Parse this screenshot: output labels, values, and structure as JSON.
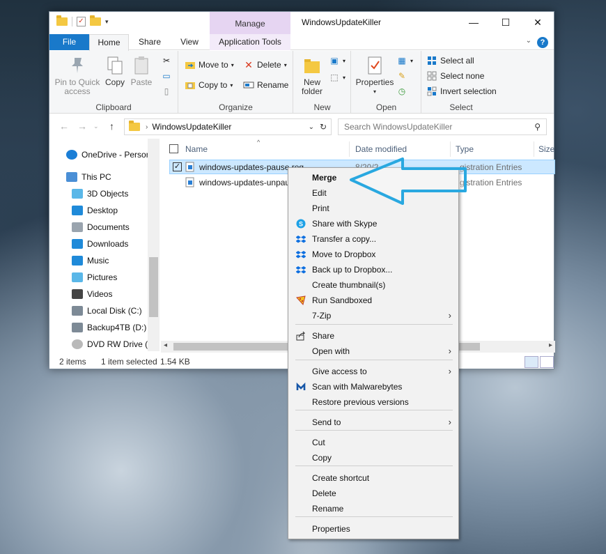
{
  "window": {
    "title": "WindowsUpdateKiller",
    "manage_label": "Manage",
    "controls": [
      "—",
      "☐",
      "✕"
    ]
  },
  "tabs": {
    "file": "File",
    "home": "Home",
    "share": "Share",
    "view": "View",
    "app_tools": "Application Tools",
    "help": "?"
  },
  "ribbon": {
    "clipboard": {
      "label": "Clipboard",
      "pin": "Pin to Quick access",
      "copy": "Copy",
      "paste": "Paste"
    },
    "organize": {
      "label": "Organize",
      "move_to": "Move to",
      "copy_to": "Copy to",
      "delete": "Delete",
      "rename": "Rename"
    },
    "new": {
      "label": "New",
      "new_folder": "New folder"
    },
    "open": {
      "label": "Open",
      "properties": "Properties"
    },
    "select": {
      "label": "Select",
      "select_all": "Select all",
      "select_none": "Select none",
      "invert": "Invert selection"
    }
  },
  "address": {
    "path": "WindowsUpdateKiller",
    "search_placeholder": "Search WindowsUpdateKiller"
  },
  "nav": {
    "items": [
      {
        "label": "OneDrive - Person",
        "icon": "onedrive-icon"
      },
      {
        "label": "This PC",
        "icon": "computer-icon"
      },
      {
        "label": "3D Objects",
        "icon": "3d-objects-icon"
      },
      {
        "label": "Desktop",
        "icon": "desktop-icon"
      },
      {
        "label": "Documents",
        "icon": "documents-icon"
      },
      {
        "label": "Downloads",
        "icon": "downloads-icon"
      },
      {
        "label": "Music",
        "icon": "music-icon"
      },
      {
        "label": "Pictures",
        "icon": "pictures-icon"
      },
      {
        "label": "Videos",
        "icon": "videos-icon"
      },
      {
        "label": "Local Disk (C:)",
        "icon": "drive-icon"
      },
      {
        "label": "Backup4TB (D:)",
        "icon": "drive-icon"
      },
      {
        "label": "DVD RW Drive (E",
        "icon": "dvd-icon"
      }
    ]
  },
  "files": {
    "columns": [
      "Name",
      "Date modified",
      "Type",
      "Size"
    ],
    "rows": [
      {
        "name": "windows-updates-pause.reg",
        "date": "8/20/2",
        "type": "gistration Entries",
        "selected": true
      },
      {
        "name": "windows-updates-unpau",
        "date": "",
        "type": "gistration Entries",
        "selected": false
      }
    ]
  },
  "status": {
    "items": "2 items",
    "selected": "1 item selected",
    "size": "1.54 KB"
  },
  "context_menu": {
    "items": [
      {
        "label": "Merge",
        "bold": true
      },
      {
        "label": "Edit"
      },
      {
        "label": "Print"
      },
      {
        "label": "Share with Skype",
        "icon": "skype-icon"
      },
      {
        "label": "Transfer a copy...",
        "icon": "dropbox-icon"
      },
      {
        "label": "Move to Dropbox",
        "icon": "dropbox-icon"
      },
      {
        "label": "Back up to Dropbox...",
        "icon": "dropbox-icon"
      },
      {
        "label": "Create thumbnail(s)"
      },
      {
        "label": "Run Sandboxed",
        "icon": "sandboxie-icon"
      },
      {
        "label": "7-Zip",
        "submenu": true
      },
      {
        "label": "Share",
        "icon": "share-icon"
      },
      {
        "label": "Open with",
        "submenu": true
      },
      {
        "label": "Give access to",
        "submenu": true
      },
      {
        "label": "Scan with Malwarebytes",
        "icon": "malwarebytes-icon"
      },
      {
        "label": "Restore previous versions"
      },
      {
        "label": "Send to",
        "submenu": true
      },
      {
        "label": "Cut"
      },
      {
        "label": "Copy"
      },
      {
        "label": "Create shortcut"
      },
      {
        "label": "Delete"
      },
      {
        "label": "Rename"
      },
      {
        "label": "Properties"
      }
    ]
  },
  "colors": {
    "accent": "#1979ca",
    "manage_tab": "#e6d5f2",
    "selection": "#cce8ff",
    "pointer": "#29a8e0"
  }
}
